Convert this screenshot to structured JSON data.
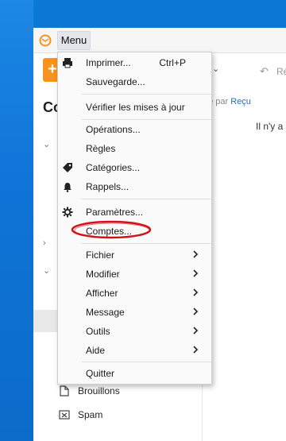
{
  "menu": {
    "button_label": "Menu",
    "items": {
      "print": {
        "label": "Imprimer...",
        "shortcut": "Ctrl+P"
      },
      "backup": {
        "label": "Sauvegarde..."
      },
      "updates": {
        "label": "Vérifier les mises à jour"
      },
      "operations": {
        "label": "Opérations..."
      },
      "rules": {
        "label": "Règles"
      },
      "categories": {
        "label": "Catégories..."
      },
      "reminders": {
        "label": "Rappels..."
      },
      "settings": {
        "label": "Paramètres..."
      },
      "accounts": {
        "label": "Comptes..."
      },
      "file": {
        "label": "Fichier"
      },
      "edit": {
        "label": "Modifier"
      },
      "view": {
        "label": "Afficher"
      },
      "message": {
        "label": "Message"
      },
      "tools": {
        "label": "Outils"
      },
      "help": {
        "label": "Aide"
      },
      "quit": {
        "label": "Quitter"
      }
    }
  },
  "background": {
    "new_button": "+",
    "heading_partial": "Co",
    "reply_partial": "Ré",
    "sort_prefix": "rié par",
    "sort_value": "Reçu",
    "empty_partial": "Il n'y a",
    "folders": {
      "drafts": "Brouillons",
      "spam": "Spam"
    }
  },
  "colors": {
    "accent": "#f7931e",
    "link": "#1f6fc2",
    "highlight": "#d0121b",
    "desktop": "#0a78d4"
  }
}
